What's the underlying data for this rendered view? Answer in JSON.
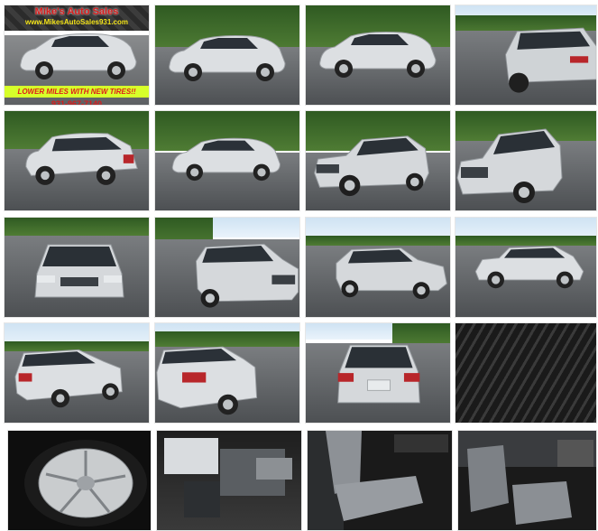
{
  "banner": {
    "dealer_name": "Mike's Auto Sales",
    "website": "www.MikesAutoSales931.com",
    "promo": "LOWER MILES WITH NEW TIRES!!",
    "phone": "931-967-7140"
  },
  "colors": {
    "car_body": "#d9dcdf",
    "banner_red": "#d91c1c",
    "promo_bg": "#d7ff2a"
  },
  "thumbnails": [
    {
      "id": "photo-1",
      "subject": "side-left-banner"
    },
    {
      "id": "photo-2",
      "subject": "side-left"
    },
    {
      "id": "photo-3",
      "subject": "side-left"
    },
    {
      "id": "photo-4",
      "subject": "rear-quarter"
    },
    {
      "id": "photo-5",
      "subject": "rear-left-quarter"
    },
    {
      "id": "photo-6",
      "subject": "side-left"
    },
    {
      "id": "photo-7",
      "subject": "front-left-quarter"
    },
    {
      "id": "photo-8",
      "subject": "front-left-quarter"
    },
    {
      "id": "photo-9",
      "subject": "front"
    },
    {
      "id": "photo-10",
      "subject": "front-right-quarter"
    },
    {
      "id": "photo-11",
      "subject": "front-right-quarter"
    },
    {
      "id": "photo-12",
      "subject": "side-right"
    },
    {
      "id": "photo-13",
      "subject": "rear-right-quarter"
    },
    {
      "id": "photo-14",
      "subject": "rear-right-quarter"
    },
    {
      "id": "photo-15",
      "subject": "rear"
    },
    {
      "id": "photo-16",
      "subject": "tire-tread"
    },
    {
      "id": "photo-17",
      "subject": "alloy-wheel"
    },
    {
      "id": "photo-18",
      "subject": "engine-bay"
    },
    {
      "id": "photo-19",
      "subject": "front-seat"
    },
    {
      "id": "photo-20",
      "subject": "interior-console"
    }
  ]
}
